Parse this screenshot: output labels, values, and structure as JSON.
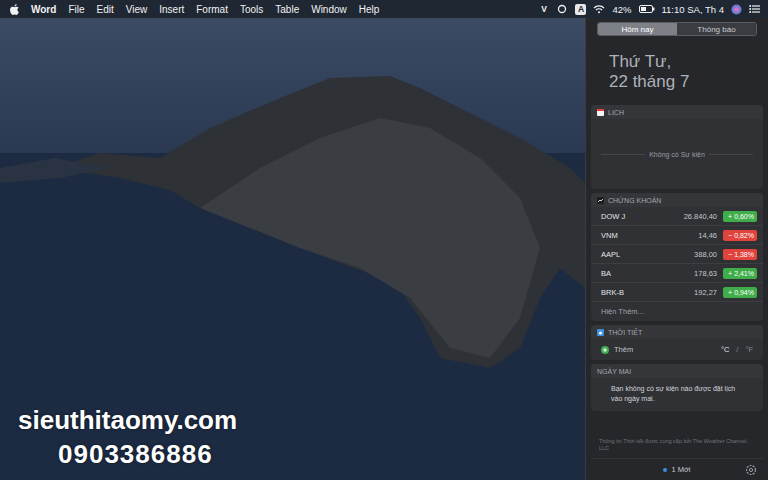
{
  "menubar": {
    "app": "Word",
    "menus": [
      "File",
      "Edit",
      "View",
      "Insert",
      "Format",
      "Tools",
      "Table",
      "Window",
      "Help"
    ],
    "status": {
      "left_badge": "V",
      "input_badge": "A",
      "battery": "42%",
      "clock": "11:10 SA, Th 4"
    }
  },
  "watermark": {
    "site": "sieuthitaomy.com",
    "phone": "0903386886"
  },
  "panel": {
    "tabs": [
      {
        "label": "Hôm nay",
        "selected": true
      },
      {
        "label": "Thông báo",
        "selected": false
      }
    ],
    "date": {
      "weekday": "Thứ Tư,",
      "day": "22 tháng 7"
    },
    "calendar": {
      "title": "LỊCH",
      "empty": "Không có Sự kiện"
    },
    "stocks": {
      "title": "CHỨNG KHOÁN",
      "rows": [
        {
          "symbol": "DOW J",
          "price": "26.840,40",
          "change": "+ 0,60%",
          "color": "#3fae4a"
        },
        {
          "symbol": "VNM",
          "price": "14,46",
          "change": "− 0,82%",
          "color": "#e0443d"
        },
        {
          "symbol": "AAPL",
          "price": "388,00",
          "change": "− 1,38%",
          "color": "#e0443d"
        },
        {
          "symbol": "BA",
          "price": "178,63",
          "change": "+ 2,41%",
          "color": "#3fae4a"
        },
        {
          "symbol": "BRK-B",
          "price": "192,27",
          "change": "+ 0,94%",
          "color": "#3fae4a"
        }
      ],
      "more": "Hiện Thêm..."
    },
    "weather": {
      "title": "THỜI TIẾT",
      "add": "Thêm",
      "separator": "/",
      "units": [
        {
          "label": "°C",
          "selected": true
        },
        {
          "label": "°F",
          "selected": false
        }
      ]
    },
    "tomorrow": {
      "title": "NGÀY MAI",
      "text": "Bạn không có sự kiện nào được đặt lịch vào ngày mai."
    },
    "footer": "Thông tin Thời tiết được cung cấp bởi The Weather Channel, LLC",
    "bottom": {
      "new": "1 Mới"
    }
  }
}
